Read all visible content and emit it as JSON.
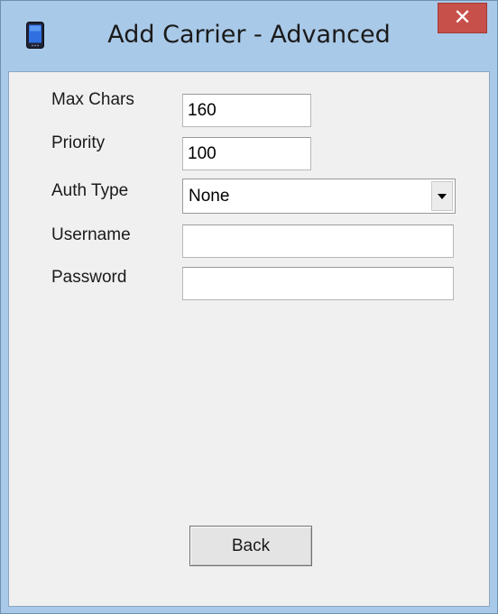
{
  "window": {
    "title": "Add Carrier - Advanced",
    "close_glyph": "✕",
    "app_icon": "phone-icon"
  },
  "form": {
    "max_chars_label": "Max Chars",
    "max_chars_value": "160",
    "priority_label": "Priority",
    "priority_value": "100",
    "auth_type_label": "Auth Type",
    "auth_type_value": "None",
    "username_label": "Username",
    "username_value": "",
    "password_label": "Password",
    "password_value": ""
  },
  "buttons": {
    "back_label": "Back"
  },
  "colors": {
    "frame": "#a9c9e8",
    "client_bg": "#f0f0f0",
    "close_red": "#c7504b"
  }
}
